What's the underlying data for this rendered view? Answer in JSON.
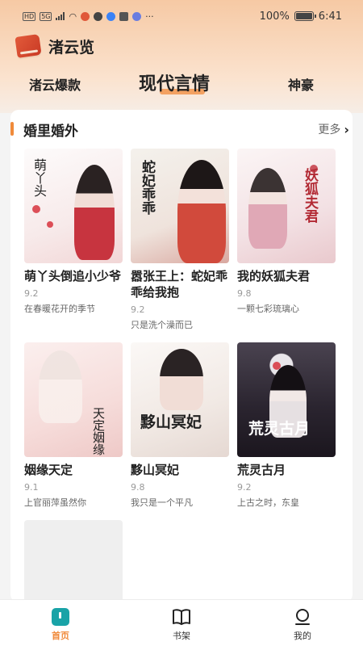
{
  "status_bar": {
    "left_tags": [
      "HD",
      "5G"
    ],
    "battery": "100%",
    "time": "6:41"
  },
  "app": {
    "title": "渚云览",
    "logo_icon": "book-stack-icon"
  },
  "tabs": [
    {
      "label": "渚云爆款",
      "active": false
    },
    {
      "label": "现代言情",
      "active": true
    },
    {
      "label": "神豪",
      "active": false
    }
  ],
  "accent_color": "#f08a3a",
  "section": {
    "title": "婚里婚外",
    "more_label": "更多",
    "more_icon": "chevron-right-icon"
  },
  "books": [
    {
      "title": "萌丫头倒追小少爷",
      "score": "9.2",
      "desc": "在春暖花开的季节",
      "cover_text": "萌丫头"
    },
    {
      "title": "嚣张王上：蛇妃乖乖给我抱",
      "score": "9.2",
      "desc": "只是洗个澡而已",
      "cover_text": "蛇妃乖乖"
    },
    {
      "title": "我的妖狐夫君",
      "score": "9.8",
      "desc": "一颗七彩琉璃心",
      "cover_text": "妖狐夫君"
    },
    {
      "title": "姻缘天定",
      "score": "9.1",
      "desc": "上官丽萍虽然你",
      "cover_text": "天定姻缘"
    },
    {
      "title": "黟山冥妃",
      "score": "9.8",
      "desc": "我只是一个平凡",
      "cover_text": "黟山冥妃"
    },
    {
      "title": "荒灵古月",
      "score": "9.2",
      "desc": "上古之时，东皇",
      "cover_text": "荒灵古月"
    }
  ],
  "bottom_nav": [
    {
      "label": "首页",
      "icon": "home-icon",
      "active": true
    },
    {
      "label": "书架",
      "icon": "bookshelf-icon",
      "active": false
    },
    {
      "label": "我的",
      "icon": "profile-icon",
      "active": false
    }
  ]
}
